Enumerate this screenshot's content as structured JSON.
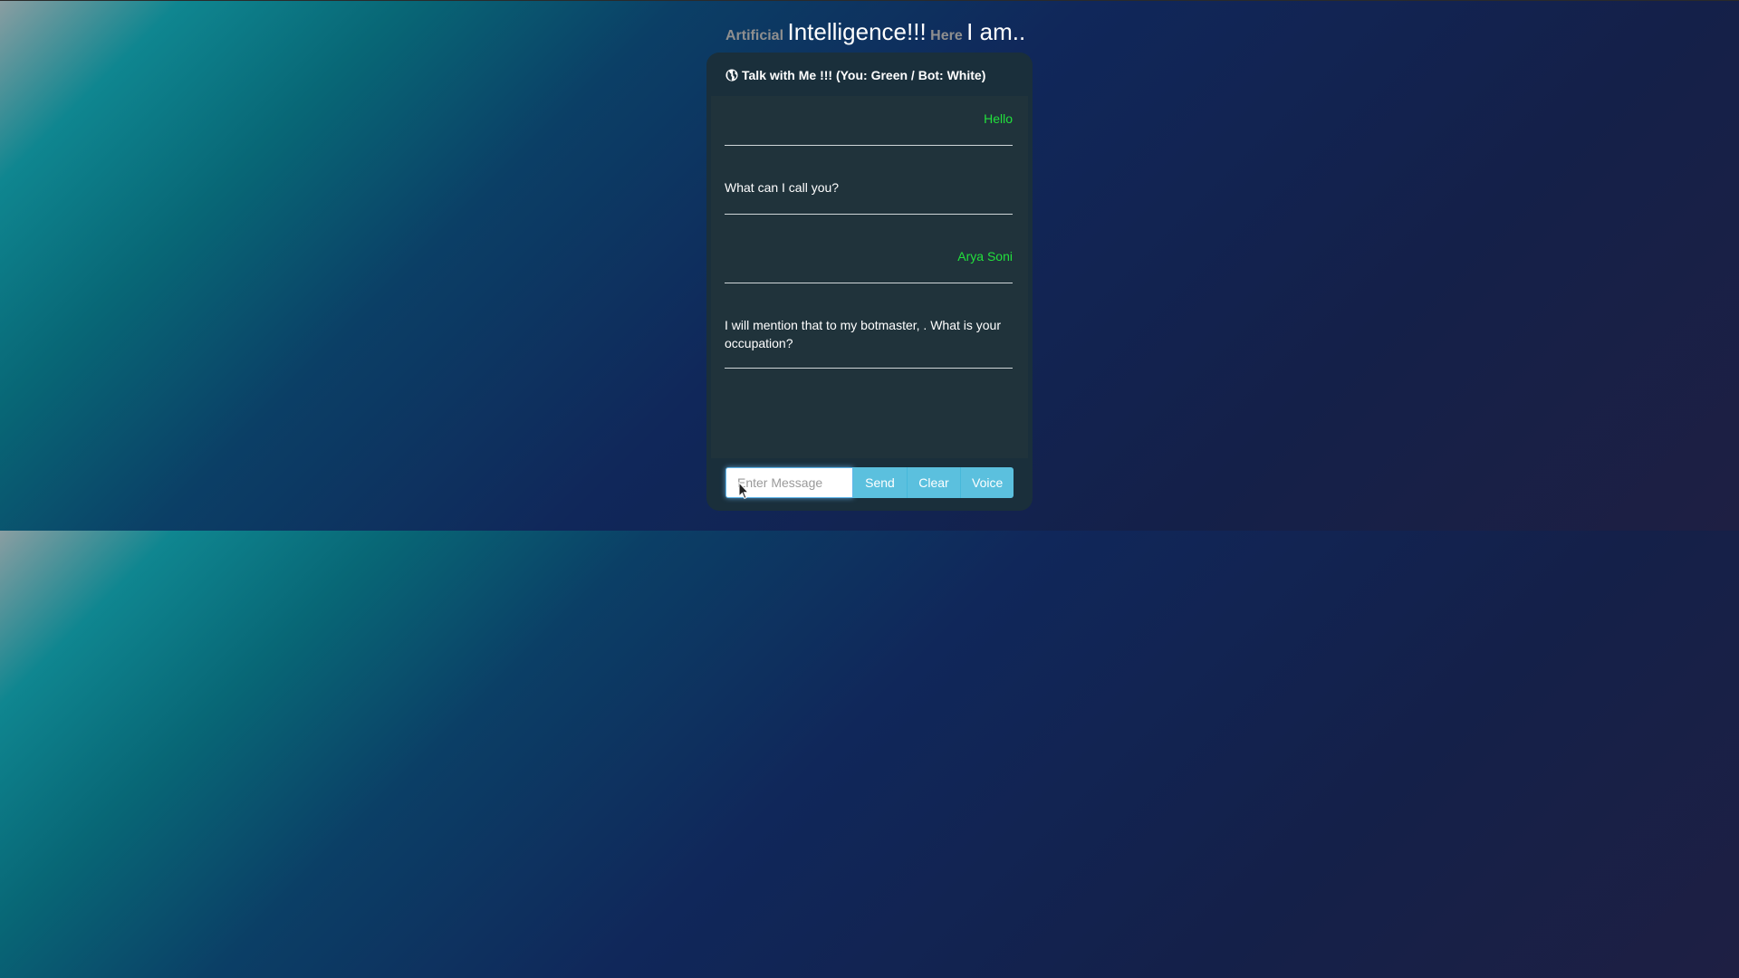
{
  "heading": {
    "word1": "Artificial",
    "word2": "Intelligence!!!",
    "word3": "Here",
    "word4": "I am.."
  },
  "chat": {
    "title": "Talk with Me !!! (You: Green / Bot: White)",
    "title_icon": "globe-icon",
    "messages": [
      {
        "sender": "user",
        "text": "Hello"
      },
      {
        "sender": "bot",
        "text": "What can I call you?"
      },
      {
        "sender": "user",
        "text": "Arya Soni"
      },
      {
        "sender": "bot",
        "text": "I will mention that to my botmaster, . What is your occupation?"
      }
    ]
  },
  "input": {
    "placeholder": "Enter Message",
    "value": ""
  },
  "buttons": {
    "send": "Send",
    "clear": "Clear",
    "voice": "Voice"
  },
  "colors": {
    "user_text": "#22e03c",
    "bot_text": "#ffffff",
    "button_bg": "#5bc0de",
    "panel_bg": "#1a2f3b"
  }
}
